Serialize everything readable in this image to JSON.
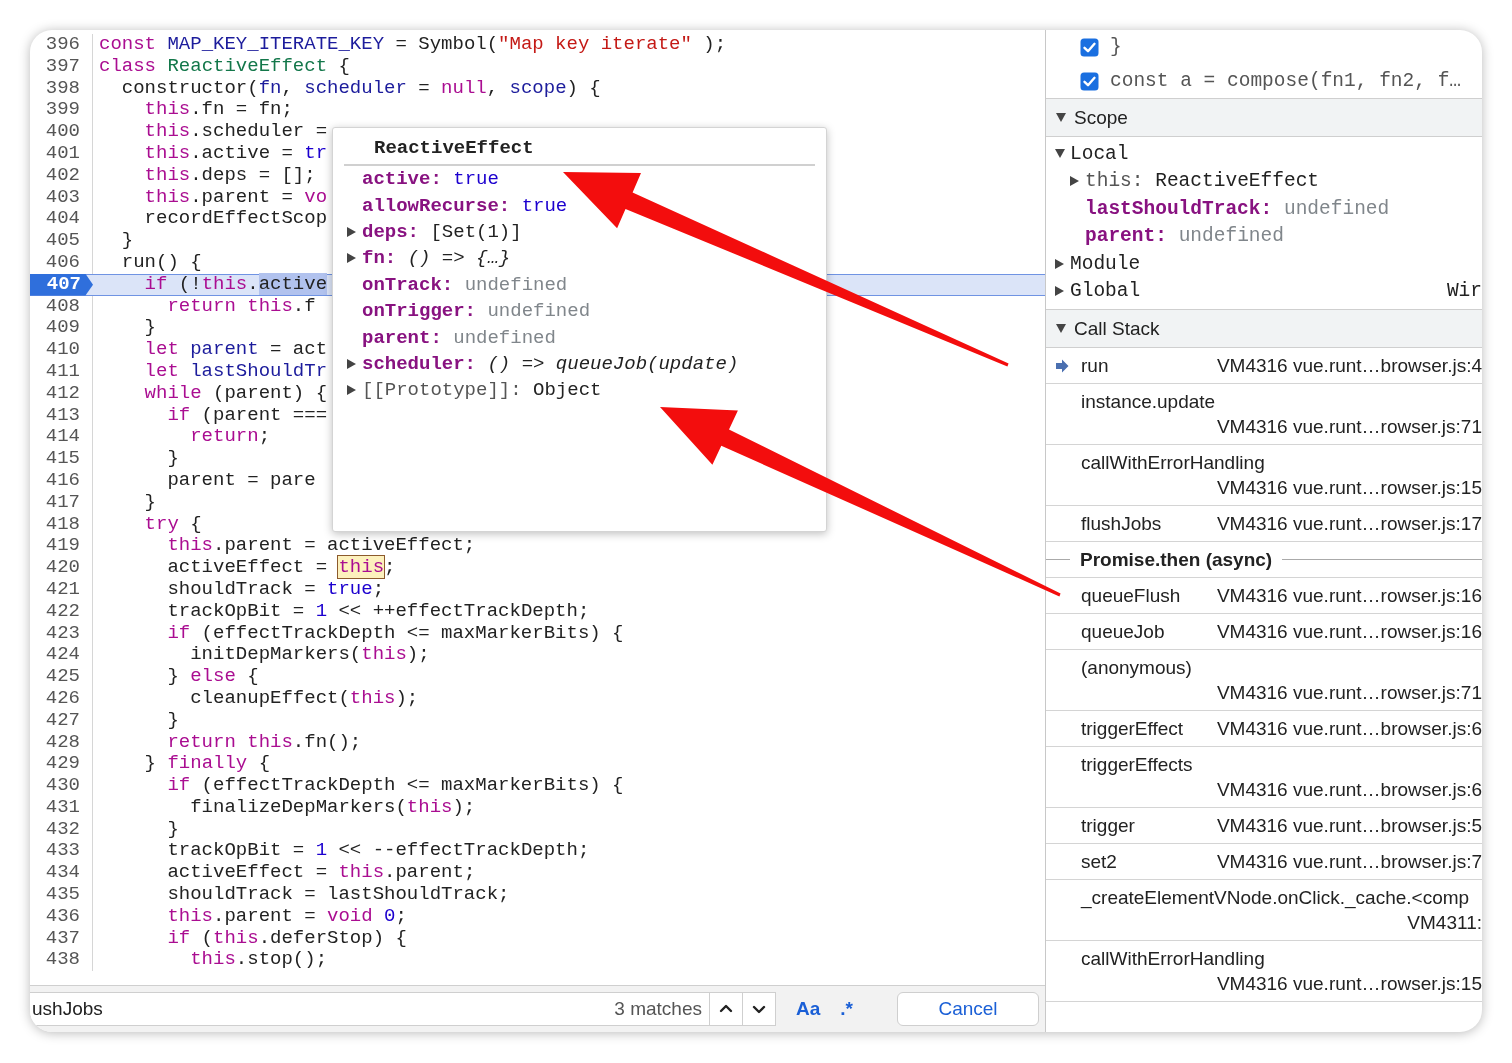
{
  "code_lines": [
    {
      "number": "396",
      "current": false,
      "tokens": [
        {
          "kind": "keyword",
          "text": "const "
        },
        {
          "kind": "definition",
          "text": "MAP_KEY_ITERATE_KEY"
        },
        {
          "kind": "plain",
          "text": " = Symbol("
        },
        {
          "kind": "string",
          "text": "\"Map key iterate\""
        },
        {
          "kind": "plain",
          "text": " );"
        }
      ]
    },
    {
      "number": "397",
      "current": false,
      "tokens": [
        {
          "kind": "keyword",
          "text": "class "
        },
        {
          "kind": "class",
          "text": "ReactiveEffect"
        },
        {
          "kind": "plain",
          "text": " {"
        }
      ]
    },
    {
      "number": "398",
      "current": false,
      "tokens": [
        {
          "kind": "plain",
          "text": "  constructor("
        },
        {
          "kind": "definition",
          "text": "fn"
        },
        {
          "kind": "plain",
          "text": ", "
        },
        {
          "kind": "definition",
          "text": "scheduler"
        },
        {
          "kind": "plain",
          "text": " = "
        },
        {
          "kind": "keyword",
          "text": "null"
        },
        {
          "kind": "plain",
          "text": ", "
        },
        {
          "kind": "definition",
          "text": "scope"
        },
        {
          "kind": "plain",
          "text": ") {"
        }
      ]
    },
    {
      "number": "399",
      "current": false,
      "tokens": [
        {
          "kind": "keyword",
          "text": "    this"
        },
        {
          "kind": "plain",
          "text": ".fn = fn;"
        }
      ]
    },
    {
      "number": "400",
      "current": false,
      "tokens": [
        {
          "kind": "keyword",
          "text": "    this"
        },
        {
          "kind": "plain",
          "text": ".scheduler ="
        }
      ]
    },
    {
      "number": "401",
      "current": false,
      "tokens": [
        {
          "kind": "keyword",
          "text": "    this"
        },
        {
          "kind": "plain",
          "text": ".active = "
        },
        {
          "kind": "atom",
          "text": "tr"
        }
      ]
    },
    {
      "number": "402",
      "current": false,
      "tokens": [
        {
          "kind": "keyword",
          "text": "    this"
        },
        {
          "kind": "plain",
          "text": ".deps = [];"
        }
      ]
    },
    {
      "number": "403",
      "current": false,
      "tokens": [
        {
          "kind": "keyword",
          "text": "    this"
        },
        {
          "kind": "plain",
          "text": ".parent = "
        },
        {
          "kind": "keyword",
          "text": "vo"
        }
      ]
    },
    {
      "number": "404",
      "current": false,
      "tokens": [
        {
          "kind": "plain",
          "text": "    recordEffectScop"
        }
      ]
    },
    {
      "number": "405",
      "current": false,
      "tokens": [
        {
          "kind": "plain",
          "text": "  }"
        }
      ]
    },
    {
      "number": "406",
      "current": false,
      "tokens": [
        {
          "kind": "plain",
          "text": "  run() {"
        }
      ]
    },
    {
      "number": "407",
      "current": true,
      "tokens": [
        {
          "kind": "keyword",
          "text": "    if"
        },
        {
          "kind": "plain",
          "text": " (!"
        },
        {
          "kind": "keyword",
          "text": "this"
        },
        {
          "kind": "plain",
          "text": "."
        },
        {
          "kind": "selection",
          "text": "active"
        }
      ]
    },
    {
      "number": "408",
      "current": false,
      "tokens": [
        {
          "kind": "keyword",
          "text": "      return "
        },
        {
          "kind": "keyword",
          "text": "this"
        },
        {
          "kind": "plain",
          "text": ".f"
        }
      ]
    },
    {
      "number": "409",
      "current": false,
      "tokens": [
        {
          "kind": "plain",
          "text": "    }"
        }
      ]
    },
    {
      "number": "410",
      "current": false,
      "tokens": [
        {
          "kind": "keyword",
          "text": "    let "
        },
        {
          "kind": "definition",
          "text": "parent"
        },
        {
          "kind": "plain",
          "text": " = act"
        }
      ]
    },
    {
      "number": "411",
      "current": false,
      "tokens": [
        {
          "kind": "keyword",
          "text": "    let "
        },
        {
          "kind": "definition",
          "text": "lastShouldTr"
        }
      ]
    },
    {
      "number": "412",
      "current": false,
      "tokens": [
        {
          "kind": "keyword",
          "text": "    while"
        },
        {
          "kind": "plain",
          "text": " (parent) {"
        }
      ]
    },
    {
      "number": "413",
      "current": false,
      "tokens": [
        {
          "kind": "keyword",
          "text": "      if"
        },
        {
          "kind": "plain",
          "text": " (parent ==="
        }
      ]
    },
    {
      "number": "414",
      "current": false,
      "tokens": [
        {
          "kind": "keyword",
          "text": "        return"
        },
        {
          "kind": "plain",
          "text": ";"
        }
      ]
    },
    {
      "number": "415",
      "current": false,
      "tokens": [
        {
          "kind": "plain",
          "text": "      }"
        }
      ]
    },
    {
      "number": "416",
      "current": false,
      "tokens": [
        {
          "kind": "plain",
          "text": "      parent = pare"
        }
      ]
    },
    {
      "number": "417",
      "current": false,
      "tokens": [
        {
          "kind": "plain",
          "text": "    }"
        }
      ]
    },
    {
      "number": "418",
      "current": false,
      "tokens": [
        {
          "kind": "keyword",
          "text": "    try"
        },
        {
          "kind": "plain",
          "text": " {"
        }
      ]
    },
    {
      "number": "419",
      "current": false,
      "tokens": [
        {
          "kind": "keyword",
          "text": "      this"
        },
        {
          "kind": "plain",
          "text": ".parent = activeEffect;"
        }
      ]
    },
    {
      "number": "420",
      "current": false,
      "tokens": [
        {
          "kind": "plain",
          "text": "      activeEffect = "
        },
        {
          "kind": "search_match",
          "text": "this"
        },
        {
          "kind": "plain",
          "text": ";"
        }
      ]
    },
    {
      "number": "421",
      "current": false,
      "tokens": [
        {
          "kind": "plain",
          "text": "      shouldTrack = "
        },
        {
          "kind": "atom",
          "text": "true"
        },
        {
          "kind": "plain",
          "text": ";"
        }
      ]
    },
    {
      "number": "422",
      "current": false,
      "tokens": [
        {
          "kind": "plain",
          "text": "      trackOpBit = "
        },
        {
          "kind": "number",
          "text": "1"
        },
        {
          "kind": "plain",
          "text": " << ++effectTrackDepth;"
        }
      ]
    },
    {
      "number": "423",
      "current": false,
      "tokens": [
        {
          "kind": "keyword",
          "text": "      if"
        },
        {
          "kind": "plain",
          "text": " (effectTrackDepth <= maxMarkerBits) {"
        }
      ]
    },
    {
      "number": "424",
      "current": false,
      "tokens": [
        {
          "kind": "plain",
          "text": "        initDepMarkers("
        },
        {
          "kind": "keyword",
          "text": "this"
        },
        {
          "kind": "plain",
          "text": ");"
        }
      ]
    },
    {
      "number": "425",
      "current": false,
      "tokens": [
        {
          "kind": "plain",
          "text": "      } "
        },
        {
          "kind": "keyword",
          "text": "else"
        },
        {
          "kind": "plain",
          "text": " {"
        }
      ]
    },
    {
      "number": "426",
      "current": false,
      "tokens": [
        {
          "kind": "plain",
          "text": "        cleanupEffect("
        },
        {
          "kind": "keyword",
          "text": "this"
        },
        {
          "kind": "plain",
          "text": ");"
        }
      ]
    },
    {
      "number": "427",
      "current": false,
      "tokens": [
        {
          "kind": "plain",
          "text": "      }"
        }
      ]
    },
    {
      "number": "428",
      "current": false,
      "tokens": [
        {
          "kind": "keyword",
          "text": "      return "
        },
        {
          "kind": "keyword",
          "text": "this"
        },
        {
          "kind": "plain",
          "text": ".fn();"
        }
      ]
    },
    {
      "number": "429",
      "current": false,
      "tokens": [
        {
          "kind": "plain",
          "text": "    } "
        },
        {
          "kind": "keyword",
          "text": "finally"
        },
        {
          "kind": "plain",
          "text": " {"
        }
      ]
    },
    {
      "number": "430",
      "current": false,
      "tokens": [
        {
          "kind": "keyword",
          "text": "      if"
        },
        {
          "kind": "plain",
          "text": " (effectTrackDepth <= maxMarkerBits) {"
        }
      ]
    },
    {
      "number": "431",
      "current": false,
      "tokens": [
        {
          "kind": "plain",
          "text": "        finalizeDepMarkers("
        },
        {
          "kind": "keyword",
          "text": "this"
        },
        {
          "kind": "plain",
          "text": ");"
        }
      ]
    },
    {
      "number": "432",
      "current": false,
      "tokens": [
        {
          "kind": "plain",
          "text": "      }"
        }
      ]
    },
    {
      "number": "433",
      "current": false,
      "tokens": [
        {
          "kind": "plain",
          "text": "      trackOpBit = "
        },
        {
          "kind": "number",
          "text": "1"
        },
        {
          "kind": "plain",
          "text": " << --effectTrackDepth;"
        }
      ]
    },
    {
      "number": "434",
      "current": false,
      "tokens": [
        {
          "kind": "plain",
          "text": "      activeEffect = "
        },
        {
          "kind": "keyword",
          "text": "this"
        },
        {
          "kind": "plain",
          "text": ".parent;"
        }
      ]
    },
    {
      "number": "435",
      "current": false,
      "tokens": [
        {
          "kind": "plain",
          "text": "      shouldTrack = lastShouldTrack;"
        }
      ]
    },
    {
      "number": "436",
      "current": false,
      "tokens": [
        {
          "kind": "keyword",
          "text": "      this"
        },
        {
          "kind": "plain",
          "text": ".parent = "
        },
        {
          "kind": "keyword",
          "text": "void "
        },
        {
          "kind": "number",
          "text": "0"
        },
        {
          "kind": "plain",
          "text": ";"
        }
      ]
    },
    {
      "number": "437",
      "current": false,
      "tokens": [
        {
          "kind": "keyword",
          "text": "      if"
        },
        {
          "kind": "plain",
          "text": " ("
        },
        {
          "kind": "keyword",
          "text": "this"
        },
        {
          "kind": "plain",
          "text": ".deferStop) {"
        }
      ]
    },
    {
      "number": "438",
      "current": false,
      "tokens": [
        {
          "kind": "keyword",
          "text": "        this"
        },
        {
          "kind": "plain",
          "text": ".stop();"
        }
      ]
    }
  ],
  "hover_popover": {
    "title": "ReactiveEffect",
    "properties": [
      {
        "name": "active:",
        "value": "true",
        "kind": "literal",
        "expandable": false
      },
      {
        "name": "allowRecurse:",
        "value": "true",
        "kind": "literal",
        "expandable": false
      },
      {
        "name": "deps:",
        "value": "[Set(1)]",
        "kind": "object",
        "expandable": true
      },
      {
        "name": "fn:",
        "value": "() => {…}",
        "kind": "function",
        "expandable": true
      },
      {
        "name": "onTrack:",
        "value": "undefined",
        "kind": "undefined",
        "expandable": false
      },
      {
        "name": "onTrigger:",
        "value": "undefined",
        "kind": "undefined",
        "expandable": false
      },
      {
        "name": "parent:",
        "value": "undefined",
        "kind": "undefined",
        "expandable": false
      },
      {
        "name": "scheduler:",
        "value": "() => queueJob(update)",
        "kind": "function",
        "expandable": true
      },
      {
        "name": "[[Prototype]]:",
        "value": "Object",
        "kind": "internal",
        "expandable": true
      }
    ]
  },
  "search_bar": {
    "value": "ushJobs",
    "match_count": "3 matches",
    "case_toggle": "Aa",
    "regex_toggle": ".*",
    "cancel": "Cancel"
  },
  "sidebar": {
    "breakpoints": [
      {
        "text": "}",
        "checked": true
      },
      {
        "text": "const a = compose(fn1, fn2, f…",
        "checked": true
      }
    ],
    "scope": {
      "title": "Scope",
      "expanded": true,
      "groups": [
        {
          "name": "Local",
          "expanded": true,
          "children": [
            {
              "name": "this:",
              "value": "ReactiveEffect",
              "kind": "receiver",
              "expandable": true
            },
            {
              "name": "lastShouldTrack:",
              "value": "undefined",
              "kind": "undefined",
              "expandable": false
            },
            {
              "name": "parent:",
              "value": "undefined",
              "kind": "undefined",
              "expandable": false
            }
          ]
        },
        {
          "name": "Module",
          "expanded": false
        },
        {
          "name": "Global",
          "expanded": false,
          "value": "Wir"
        }
      ]
    },
    "call_stack": {
      "title": "Call Stack",
      "expanded": true,
      "frames": [
        {
          "kind": "frame",
          "name": "run",
          "location": "VM4316 vue.runt…browser.js:4",
          "current": true
        },
        {
          "kind": "frame",
          "name": "instance.update",
          "location": "VM4316 vue.runt…rowser.js:71",
          "current": false
        },
        {
          "kind": "frame",
          "name": "callWithErrorHandling",
          "location": "VM4316 vue.runt…rowser.js:15",
          "current": false
        },
        {
          "kind": "frame",
          "name": "flushJobs",
          "location": "VM4316 vue.runt…rowser.js:17",
          "current": false
        },
        {
          "kind": "async",
          "name": "Promise.then (async)",
          "current": false
        },
        {
          "kind": "frame",
          "name": "queueFlush",
          "location": "VM4316 vue.runt…rowser.js:16",
          "current": false
        },
        {
          "kind": "frame",
          "name": "queueJob",
          "location": "VM4316 vue.runt…rowser.js:16",
          "current": false
        },
        {
          "kind": "frame",
          "name": "(anonymous)",
          "location": "VM4316 vue.runt…rowser.js:71",
          "current": false
        },
        {
          "kind": "frame",
          "name": "triggerEffect",
          "location": "VM4316 vue.runt…browser.js:6",
          "current": false
        },
        {
          "kind": "frame",
          "name": "triggerEffects",
          "location": "VM4316 vue.runt…browser.js:6",
          "current": false
        },
        {
          "kind": "frame",
          "name": "trigger",
          "location": "VM4316 vue.runt…browser.js:5",
          "current": false
        },
        {
          "kind": "frame",
          "name": "set2",
          "location": "VM4316 vue.runt…browser.js:7",
          "current": false
        },
        {
          "kind": "frame",
          "name": "_createElementVNode.onClick._cache.<comp",
          "location": "VM4311:",
          "current": false
        },
        {
          "kind": "frame",
          "name": "callWithErrorHandling",
          "location": "VM4316 vue.runt…rowser.js:15",
          "current": false
        }
      ]
    }
  }
}
